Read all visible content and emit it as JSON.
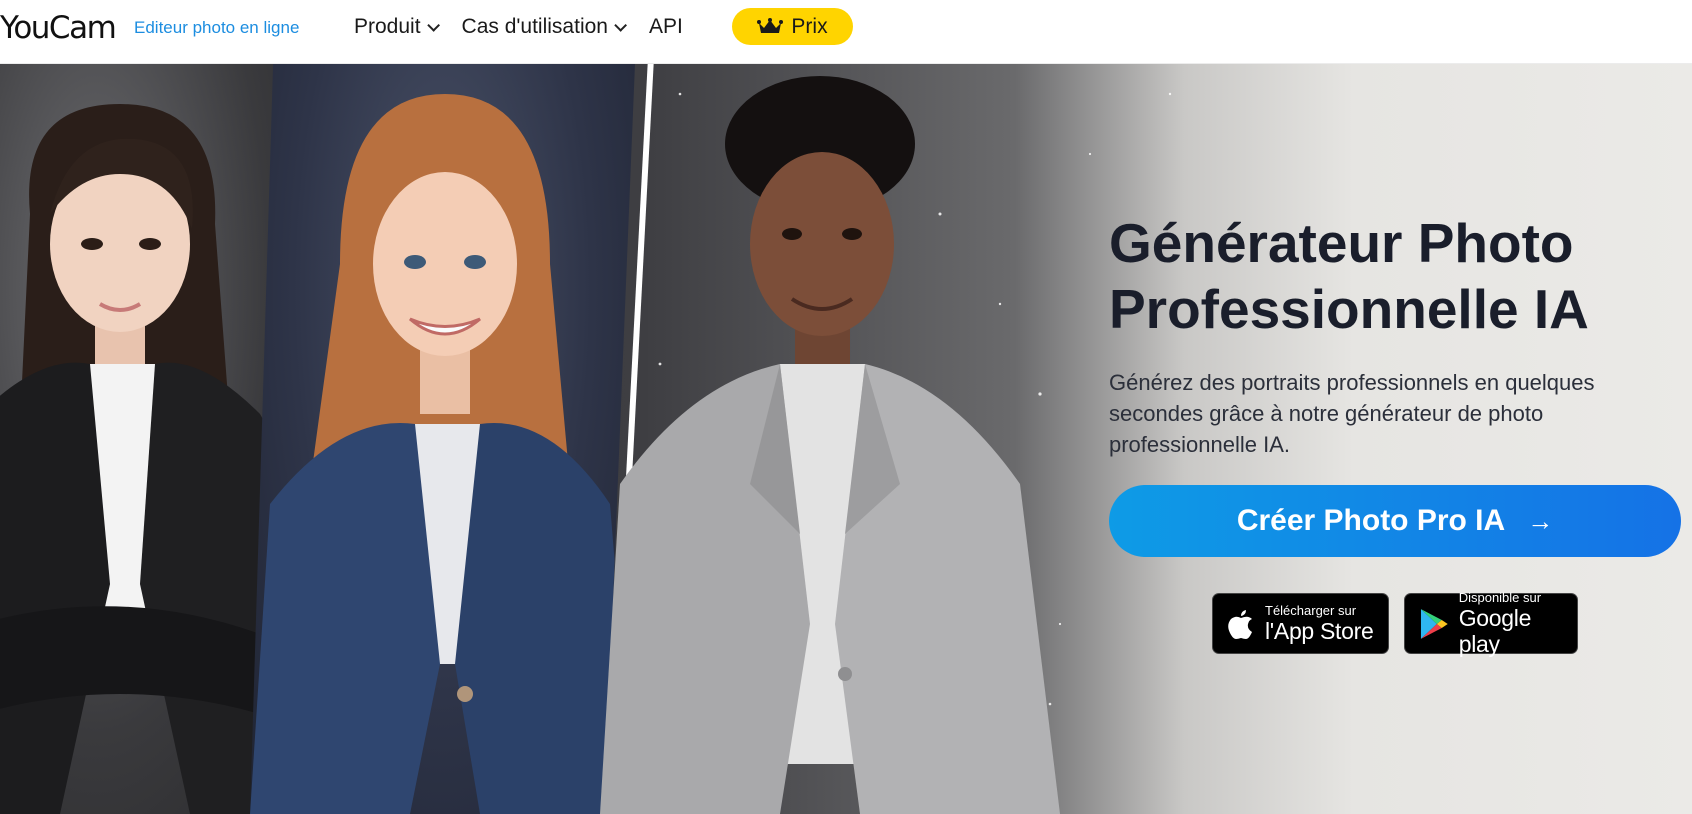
{
  "brand": {
    "logo": "YouCam",
    "tagline": "Editeur photo en ligne"
  },
  "nav": {
    "items": [
      {
        "label": "Produit",
        "has_dropdown": true
      },
      {
        "label": "Cas d'utilisation",
        "has_dropdown": true
      },
      {
        "label": "API",
        "has_dropdown": false
      }
    ],
    "pricing_label": "Prix",
    "pricing_icon": "crown-icon"
  },
  "hero": {
    "title_line1": "Générateur Photo",
    "title_line2": "Professionnelle IA",
    "description": "Générez des portraits professionnels en quelques secondes grâce à notre générateur de photo professionnelle IA.",
    "cta_label": "Créer Photo Pro IA",
    "cta_icon": "arrow-right-icon"
  },
  "stores": {
    "apple": {
      "small": "Télécharger sur",
      "big": "l'App Store",
      "icon": "apple-icon"
    },
    "google": {
      "small": "Disponible sur",
      "big": "Google play",
      "icon": "google-play-icon"
    }
  },
  "colors": {
    "accent_blue": "#1c8de0",
    "cta_start": "#0e9be6",
    "cta_end": "#1572e6",
    "pricing_yellow": "#ffd400",
    "title_dark": "#1a1e2b"
  }
}
